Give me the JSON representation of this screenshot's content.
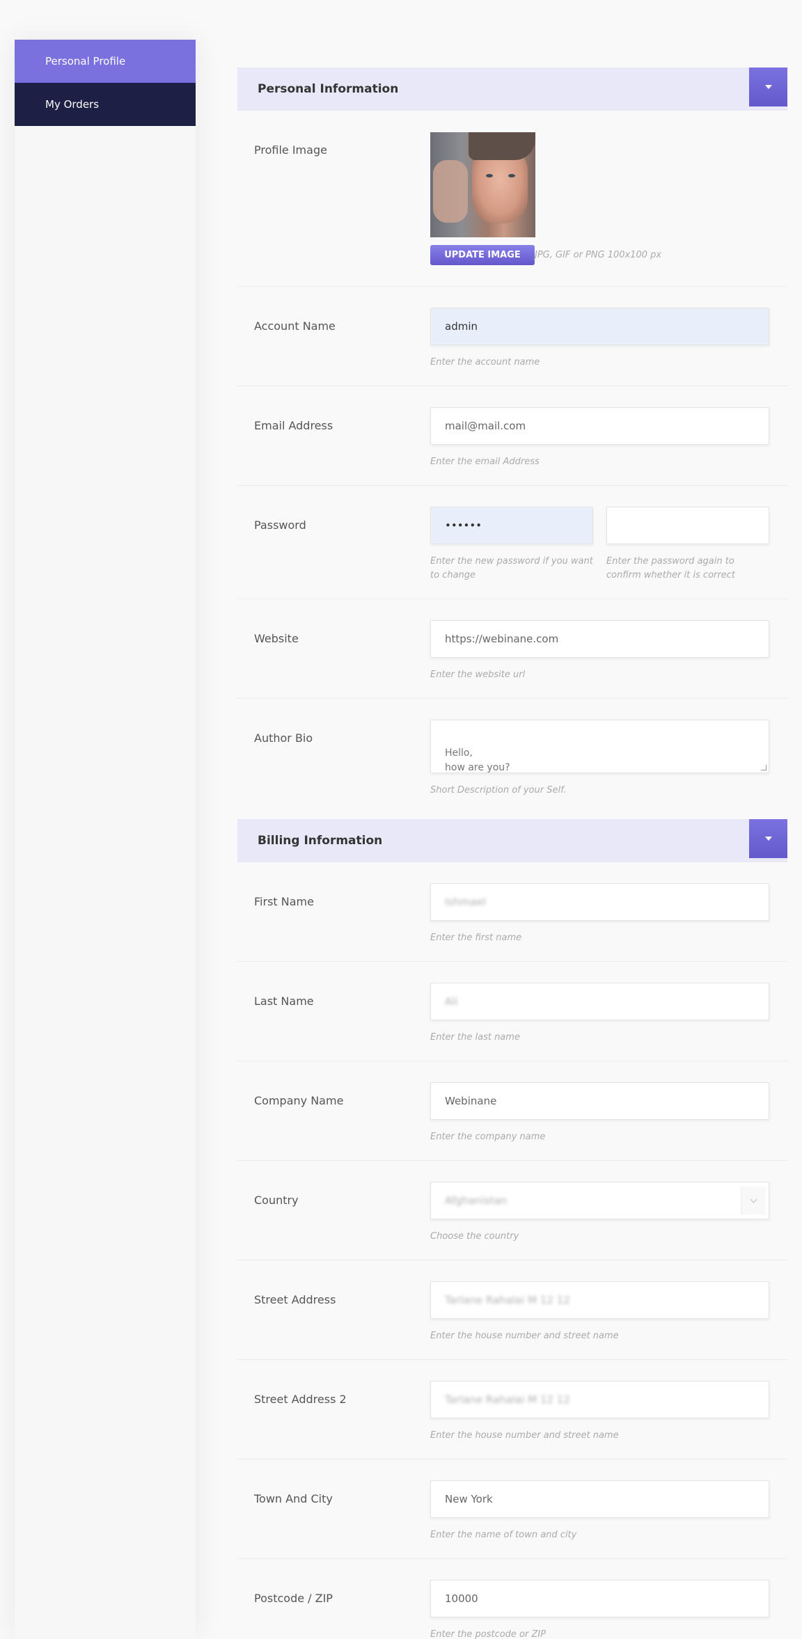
{
  "sidebar": {
    "items": [
      {
        "label": "Personal Profile"
      },
      {
        "label": "My Orders"
      }
    ]
  },
  "personal": {
    "title": "Personal Information",
    "profile_image": {
      "label": "Profile Image",
      "button": "UPDATE IMAGE",
      "hint": "JPG, GIF or PNG 100x100 px"
    },
    "account_name": {
      "label": "Account Name",
      "value": "admin",
      "hint": "Enter the account name"
    },
    "email": {
      "label": "Email Address",
      "value": "mail@mail.com",
      "hint": "Enter the email Address"
    },
    "password": {
      "label": "Password",
      "value": "••••••",
      "confirm_value": "",
      "hint": "Enter the new password if you want to change",
      "confirm_hint": "Enter the password again to confirm whether it is correct"
    },
    "website": {
      "label": "Website",
      "value": "https://webinane.com",
      "hint": "Enter the website url"
    },
    "bio": {
      "label": "Author Bio",
      "value": "Hello,\nhow are you?",
      "hint": "Short Description of your Self."
    }
  },
  "billing": {
    "title": "Billing Information",
    "first_name": {
      "label": "First Name",
      "value": "Ishmael",
      "hint": "Enter the first name"
    },
    "last_name": {
      "label": "Last Name",
      "value": "Ali",
      "hint": "Enter the last name"
    },
    "company": {
      "label": "Company Name",
      "value": "Webinane",
      "hint": "Enter the company name"
    },
    "country": {
      "label": "Country",
      "value": "Afghanistan",
      "hint": "Choose the country"
    },
    "street1": {
      "label": "Street Address",
      "value": "Tarlane Rahalai M 12 12",
      "hint": "Enter the house number and street name"
    },
    "street2": {
      "label": "Street Address 2",
      "value": "Tarlane Rahalai M 12 12",
      "hint": "Enter the house number and street name"
    },
    "town": {
      "label": "Town And City",
      "value": "New York",
      "hint": "Enter the name of town and city"
    },
    "postcode": {
      "label": "Postcode / ZIP",
      "value": "10000",
      "hint": "Enter the postcode or ZIP"
    }
  },
  "colors": {
    "accent": "#7a70de",
    "sidebar_dark": "#1d1f44",
    "section_header_bg": "#e9e8f9"
  }
}
